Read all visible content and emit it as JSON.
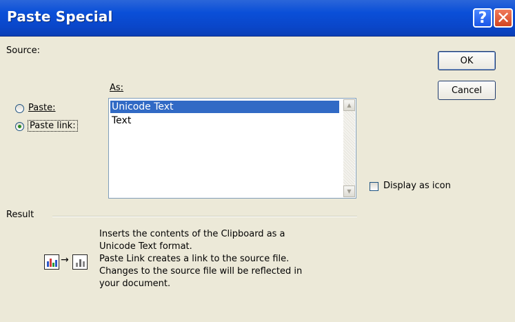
{
  "window": {
    "title": "Paste Special",
    "help_icon": "question-mark",
    "close_icon": "x-mark"
  },
  "source": {
    "label": "Source:"
  },
  "as": {
    "label": "As:",
    "items": [
      "Unicode Text",
      "Text"
    ],
    "selected_index": 0
  },
  "options": {
    "paste_label": "Paste:",
    "paste_link_label": "Paste link:",
    "selected": "paste_link"
  },
  "buttons": {
    "ok_label": "OK",
    "cancel_label": "Cancel"
  },
  "display_as_icon": {
    "label": "Display as icon",
    "checked": false
  },
  "result": {
    "label": "Result",
    "lines": [
      "Inserts the contents of the Clipboard as a",
      "Unicode Text format.",
      "Paste Link creates a link to the source file.",
      "Changes to the source file will be reflected in",
      "your document."
    ],
    "icon": "paste-link-chart-icon"
  },
  "colors": {
    "titlebar": "#0a46c9",
    "dialog_bg": "#ece9d8",
    "selection": "#316ac5"
  }
}
